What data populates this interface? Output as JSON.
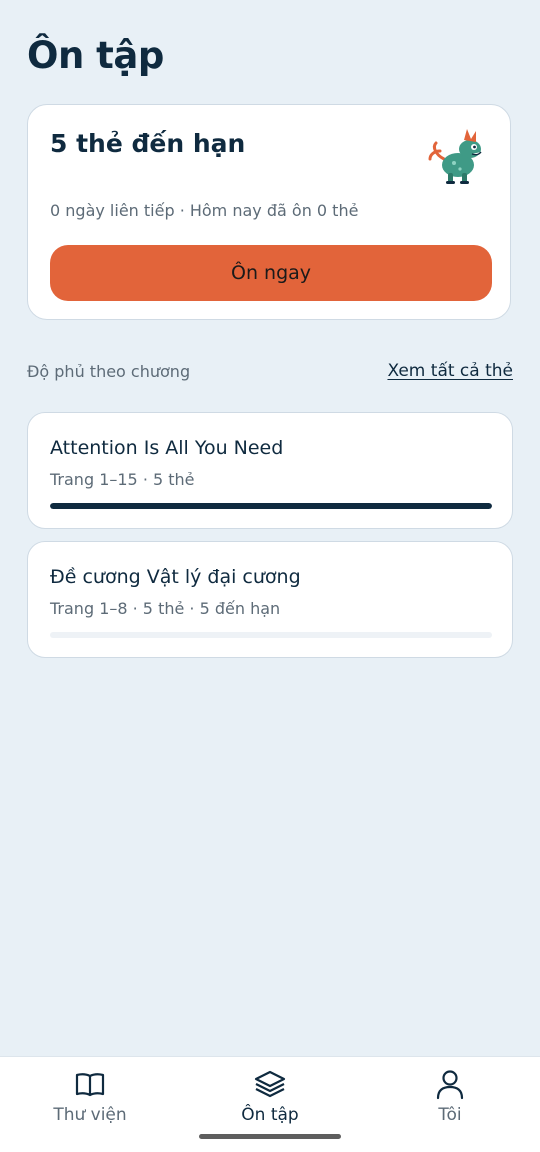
{
  "page": {
    "title": "Ôn tập"
  },
  "due_card": {
    "title": "5 thẻ đến hạn",
    "streak_text": "0 ngày liên tiếp · Hôm nay đã ôn 0 thẻ",
    "button_label": "Ôn ngay",
    "mascot_icon": "dinosaur-mascot-icon"
  },
  "coverage": {
    "label": "Độ phủ theo chương",
    "see_all_label": "Xem tất cả thẻ"
  },
  "chapters": [
    {
      "title": "Attention Is All You Need",
      "meta": "Trang 1–15 · 5 thẻ",
      "progress": 1.0
    },
    {
      "title": "Đề cương Vật lý đại cương",
      "meta": "Trang 1–8 · 5 thẻ · 5 đến hạn",
      "progress": 0.0
    }
  ],
  "bottom_nav": {
    "items": [
      {
        "label": "Thư viện",
        "icon": "book-icon",
        "active": false
      },
      {
        "label": "Ôn tập",
        "icon": "layers-icon",
        "active": true
      },
      {
        "label": "Tôi",
        "icon": "user-icon",
        "active": false
      }
    ]
  },
  "colors": {
    "background": "#e8f0f6",
    "primary_dark": "#0f2a3f",
    "accent": "#e2643a",
    "muted_text": "#5d6b77",
    "card": "#ffffff"
  }
}
